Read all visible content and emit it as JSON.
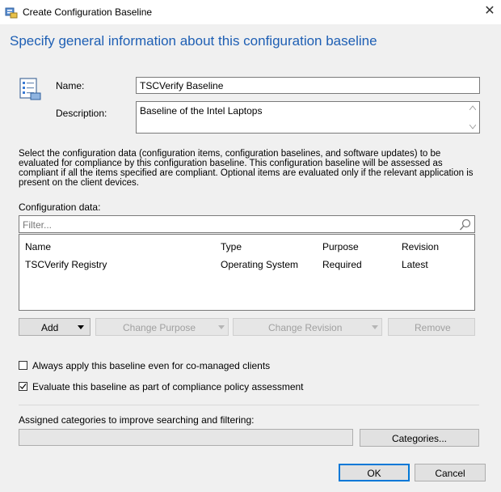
{
  "window": {
    "title": "Create Configuration Baseline",
    "close_glyph": "✕"
  },
  "heading": "Specify general information about this configuration baseline",
  "general": {
    "name_label": "Name:",
    "name_value": "TSCVerify Baseline",
    "description_label": "Description:",
    "description_value": "Baseline of the Intel Laptops"
  },
  "instructions": "Select the configuration data (configuration items, configuration baselines, and software updates) to be evaluated for compliance by this configuration baseline. This configuration baseline will be assessed as compliant if all the items specified are compliant. Optional items are evaluated only if the relevant application is present on  the client devices.",
  "configuration_data": {
    "label": "Configuration data:",
    "filter_placeholder": "Filter...",
    "columns": [
      "Name",
      "Type",
      "Purpose",
      "Revision"
    ],
    "rows": [
      [
        "TSCVerify Registry",
        "Operating System",
        "Required",
        "Latest"
      ]
    ]
  },
  "buttons": {
    "add": "Add",
    "change_purpose": "Change Purpose",
    "change_revision": "Change Revision",
    "remove": "Remove",
    "categories": "Categories...",
    "ok": "OK",
    "cancel": "Cancel"
  },
  "options": {
    "always_apply": {
      "label": "Always apply this baseline even for co-managed clients",
      "checked": false
    },
    "evaluate_compliance": {
      "label": "Evaluate this baseline as part of compliance policy assessment",
      "checked": true
    }
  },
  "categories_label": "Assigned categories to improve searching and filtering:",
  "categories_value": ""
}
